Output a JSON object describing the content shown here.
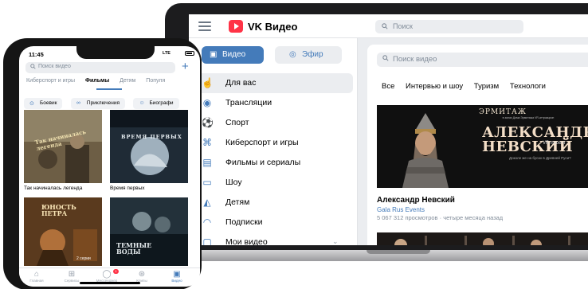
{
  "laptop": {
    "brand": "VK Видео",
    "top_search_placeholder": "Поиск",
    "sidebar": {
      "video_button": "Видео",
      "efir_button": "Эфир",
      "items": [
        {
          "label": "Для вас",
          "icon": "thumbs-up-icon",
          "active": true
        },
        {
          "label": "Трансляции",
          "icon": "broadcast-icon"
        },
        {
          "label": "Спорт",
          "icon": "ball-icon"
        },
        {
          "label": "Киберспорт и игры",
          "icon": "gamepad-icon"
        },
        {
          "label": "Фильмы и сериалы",
          "icon": "film-icon"
        },
        {
          "label": "Шоу",
          "icon": "tv-icon"
        },
        {
          "label": "Детям",
          "icon": "kids-icon"
        },
        {
          "label": "Подписки",
          "icon": "subscriptions-icon"
        },
        {
          "label": "Мои видео",
          "icon": "my-video-icon"
        }
      ]
    },
    "main": {
      "search_placeholder": "Поиск видео",
      "categories": [
        "Все",
        "Интервью и шоу",
        "Туризм",
        "Технологи"
      ],
      "hero": {
        "brand": "ЭРМИТАЖ",
        "note": "в залах Дома Эрмитажа VR-аттракцион",
        "title_line1": "АЛЕКСАНДР",
        "title_line2": "НЕВСКИЙ",
        "vr_tag": "VR-проект",
        "subtitle": "Доколе же на бусах в Древней Руси?"
      },
      "video": {
        "title": "Александр Невский",
        "channel": "Gala Rus Events",
        "meta": "5 067 312 просмотров · четыре месяца назад"
      }
    }
  },
  "phone": {
    "status_time": "11:45",
    "status_network": "LTE",
    "search_placeholder": "Поиск видео",
    "tabs": [
      {
        "label": "Киберспорт и игры"
      },
      {
        "label": "Фильмы",
        "active": true
      },
      {
        "label": "Детям"
      },
      {
        "label": "Популя"
      }
    ],
    "chips": [
      {
        "label": "Боевик",
        "icon": "target-icon"
      },
      {
        "label": "Приключения",
        "icon": "binoculars-icon"
      },
      {
        "label": "Биографи",
        "icon": "person-icon"
      }
    ],
    "tiles": [
      {
        "caption": "Так начиналась легенда",
        "overlay": "Так начиналась легенда"
      },
      {
        "caption": "Время первых",
        "overlay": "ВРЕМЯ ПЕРВЫХ"
      },
      {
        "caption": "",
        "overlay": "ЮНОСТЬ ПЕТРА",
        "badge": "2 серии"
      },
      {
        "caption": "",
        "overlay": "ТЕМНЫЕ ВОДЫ"
      }
    ],
    "tabbar": [
      {
        "label": "Главная",
        "icon": "home-icon"
      },
      {
        "label": "Сервисы",
        "icon": "grid-icon"
      },
      {
        "label": "Мессенджер",
        "icon": "chat-icon",
        "badge": "1"
      },
      {
        "label": "Клипы",
        "icon": "clips-icon"
      },
      {
        "label": "Видео",
        "icon": "video-icon",
        "active": true
      }
    ]
  },
  "colors": {
    "accent": "#447bba",
    "brand_red": "#ff3347",
    "link": "#447bba",
    "muted": "#818c99"
  }
}
